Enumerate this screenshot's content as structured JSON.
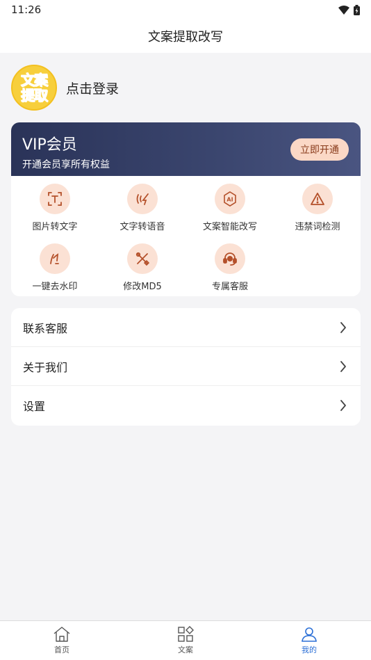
{
  "status_bar": {
    "time": "11:26"
  },
  "header": {
    "title": "文案提取改写"
  },
  "profile": {
    "avatar_line1": "文案",
    "avatar_line2": "提取",
    "login_label": "点击登录"
  },
  "vip": {
    "title": "VIP会员",
    "subtitle": "开通会员享所有权益",
    "button_label": "立即开通",
    "accent": "#2a3358",
    "button_color": "#fbd8c6"
  },
  "features": [
    {
      "label": "图片转文字",
      "icon": "image-to-text-icon"
    },
    {
      "label": "文字转语音",
      "icon": "text-to-speech-icon"
    },
    {
      "label": "文案智能改写",
      "icon": "ai-rewrite-icon"
    },
    {
      "label": "违禁词检测",
      "icon": "warning-icon"
    },
    {
      "label": "一键去水印",
      "icon": "watermark-remove-icon"
    },
    {
      "label": "修改MD5",
      "icon": "tools-icon"
    },
    {
      "label": "专属客服",
      "icon": "headset-icon"
    }
  ],
  "menu": [
    {
      "label": "联系客服"
    },
    {
      "label": "关于我们"
    },
    {
      "label": "设置"
    }
  ],
  "tabs": [
    {
      "label": "首页",
      "icon": "home-icon"
    },
    {
      "label": "文案",
      "icon": "grid-icon"
    },
    {
      "label": "我的",
      "icon": "user-icon",
      "active": true
    }
  ],
  "colors": {
    "active_tab": "#2b6fd6",
    "feature_icon_bg": "#fbe1d4",
    "feature_icon_fg": "#b4502a"
  }
}
